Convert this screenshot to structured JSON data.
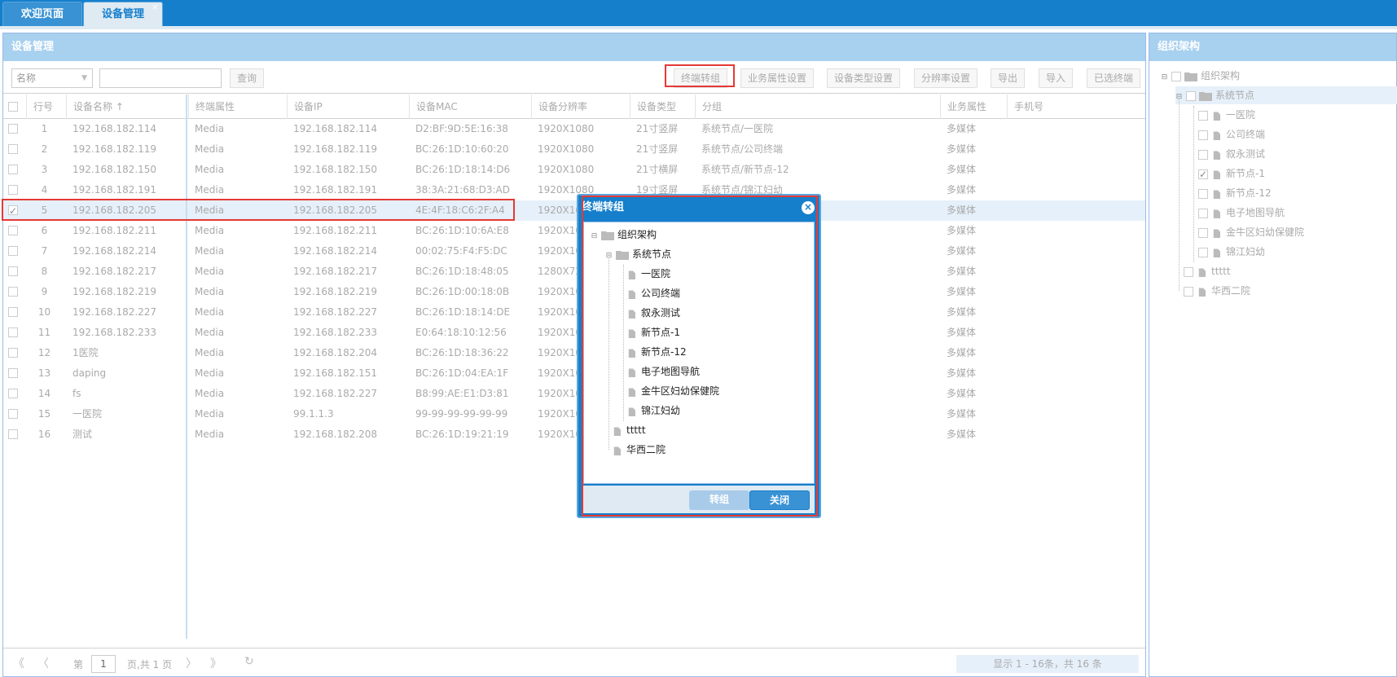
{
  "tabs": [
    {
      "label": "欢迎页面"
    },
    {
      "label": "设备管理",
      "close": "×"
    }
  ],
  "main": {
    "title": "设备管理",
    "search": {
      "field": "名称",
      "query_label": "查询"
    },
    "toolbar": {
      "move_group": "终端转组",
      "business_attr": "业务属性设置",
      "device_type": "设备类型设置",
      "resolution": "分辨率设置",
      "export": "导出",
      "import": "导入",
      "selected": "已选终端"
    },
    "columns": {
      "row_no": "行号",
      "name": "设备名称",
      "terminal_attr": "终端属性",
      "ip": "设备IP",
      "mac": "设备MAC",
      "resolution": "设备分辨率",
      "type": "设备类型",
      "group": "分组",
      "business": "业务属性",
      "phone": "手机号"
    },
    "rows": [
      {
        "no": "1",
        "name": "192.168.182.114",
        "attr": "Media",
        "ip": "192.168.182.114",
        "mac": "D2:BF:9D:5E:16:38",
        "res": "1920X1080",
        "type": "21寸竖屏",
        "group": "系统节点/一医院",
        "biz": "多媒体"
      },
      {
        "no": "2",
        "name": "192.168.182.119",
        "attr": "Media",
        "ip": "192.168.182.119",
        "mac": "BC:26:1D:10:60:20",
        "res": "1920X1080",
        "type": "21寸竖屏",
        "group": "系统节点/公司终端",
        "biz": "多媒体"
      },
      {
        "no": "3",
        "name": "192.168.182.150",
        "attr": "Media",
        "ip": "192.168.182.150",
        "mac": "BC:26:1D:18:14:D6",
        "res": "1920X1080",
        "type": "21寸横屏",
        "group": "系统节点/新节点-12",
        "biz": "多媒体"
      },
      {
        "no": "4",
        "name": "192.168.182.191",
        "attr": "Media",
        "ip": "192.168.182.191",
        "mac": "38:3A:21:68:D3:AD",
        "res": "1920X1080",
        "type": "19寸竖屏",
        "group": "系统节点/锦江妇幼",
        "biz": "多媒体"
      },
      {
        "no": "5",
        "name": "192.168.182.205",
        "attr": "Media",
        "ip": "192.168.182.205",
        "mac": "4E:4F:18:C6:2F:A4",
        "res": "1920X108",
        "type": "",
        "group": "",
        "biz": "多媒体"
      },
      {
        "no": "6",
        "name": "192.168.182.211",
        "attr": "Media",
        "ip": "192.168.182.211",
        "mac": "BC:26:1D:10:6A:E8",
        "res": "1920X108",
        "type": "",
        "group": "",
        "biz": "多媒体"
      },
      {
        "no": "7",
        "name": "192.168.182.214",
        "attr": "Media",
        "ip": "192.168.182.214",
        "mac": "00:02:75:F4:F5:DC",
        "res": "1920X108",
        "type": "",
        "group": "",
        "biz": "多媒体"
      },
      {
        "no": "8",
        "name": "192.168.182.217",
        "attr": "Media",
        "ip": "192.168.182.217",
        "mac": "BC:26:1D:18:48:05",
        "res": "1280X720",
        "type": "",
        "group": "",
        "biz": "多媒体"
      },
      {
        "no": "9",
        "name": "192.168.182.219",
        "attr": "Media",
        "ip": "192.168.182.219",
        "mac": "BC:26:1D:00:18:0B",
        "res": "1920X108",
        "type": "",
        "group": "",
        "biz": "多媒体"
      },
      {
        "no": "10",
        "name": "192.168.182.227",
        "attr": "Media",
        "ip": "192.168.182.227",
        "mac": "BC:26:1D:18:14:DE",
        "res": "1920X108",
        "type": "",
        "group": "",
        "biz": "多媒体"
      },
      {
        "no": "11",
        "name": "192.168.182.233",
        "attr": "Media",
        "ip": "192.168.182.233",
        "mac": "E0:64:18:10:12:56",
        "res": "1920X108",
        "type": "",
        "group": "",
        "biz": "多媒体"
      },
      {
        "no": "12",
        "name": "1医院",
        "attr": "Media",
        "ip": "192.168.182.204",
        "mac": "BC:26:1D:18:36:22",
        "res": "1920X108",
        "type": "",
        "group": "",
        "biz": "多媒体"
      },
      {
        "no": "13",
        "name": "daping",
        "attr": "Media",
        "ip": "192.168.182.151",
        "mac": "BC:26:1D:04:EA:1F",
        "res": "1920X108",
        "type": "",
        "group": "",
        "biz": "多媒体"
      },
      {
        "no": "14",
        "name": "fs",
        "attr": "Media",
        "ip": "192.168.182.227",
        "mac": "B8:99:AE:E1:D3:81",
        "res": "1920X108",
        "type": "",
        "group": "",
        "biz": "多媒体"
      },
      {
        "no": "15",
        "name": "一医院",
        "attr": "Media",
        "ip": "99.1.1.3",
        "mac": "99-99-99-99-99-99",
        "res": "1920X108",
        "type": "",
        "group": "",
        "biz": "多媒体"
      },
      {
        "no": "16",
        "name": "测试",
        "attr": "Media",
        "ip": "192.168.182.208",
        "mac": "BC:26:1D:19:21:19",
        "res": "1920X108",
        "type": "",
        "group": "",
        "biz": "多媒体"
      }
    ],
    "pager": {
      "page_prefix": "第",
      "page": "1",
      "page_suffix": "页,共 1 页",
      "info": "显示 1 - 16条，共 16 条"
    }
  },
  "org": {
    "title": "组织架构",
    "root": "组织架构",
    "system": "系统节点",
    "children": [
      "一医院",
      "公司终端",
      "叙永测试",
      "新节点-1",
      "新节点-12",
      "电子地图导航",
      "金牛区妇幼保健院",
      "锦江妇幼"
    ],
    "checked_child": "新节点-1",
    "siblings": [
      "ttttt",
      "华西二院"
    ]
  },
  "dialog": {
    "title": "终端转组",
    "close": "×",
    "confirm": "转组",
    "cancel": "关闭"
  },
  "colors": {
    "accent": "#157fcc",
    "highlight": "#e53935",
    "header": "#a8d0ef"
  }
}
